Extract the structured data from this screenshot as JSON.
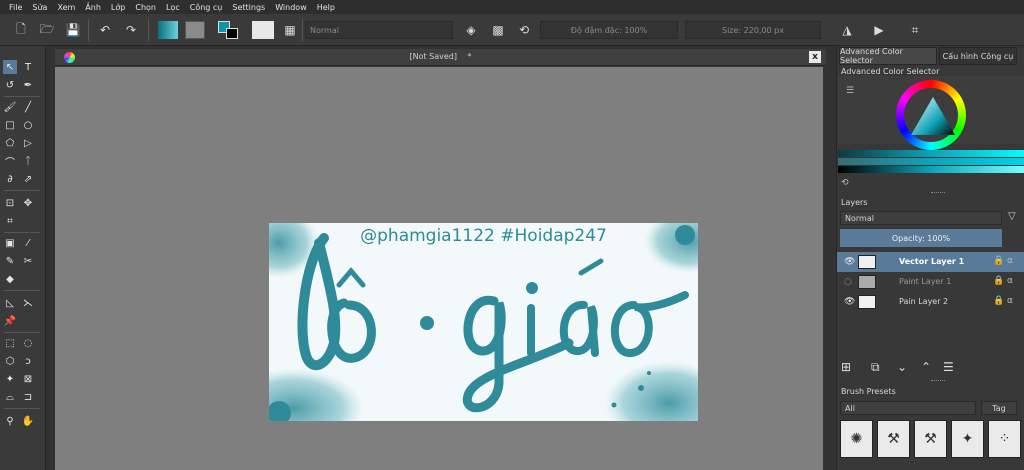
{
  "menu": [
    "File",
    "Sửa",
    "Xem",
    "Ảnh",
    "Lớp",
    "Chọn",
    "Lọc",
    "Công cụ",
    "Settings",
    "Window",
    "Help"
  ],
  "toolbar": {
    "blend_mode": "Normal",
    "opacity_label": "Độ đậm đặc: 100%",
    "size_label": "Size: 220,00 px",
    "colors": {
      "foreground": "#0f93a6",
      "background": "#000000",
      "accent": "#0ea3b8"
    }
  },
  "document": {
    "title": "[Not Saved]",
    "modified_mark": "*",
    "close_label": "x",
    "artwork": {
      "handle_text": "@phamgia1122 #Hoidap247",
      "main_text": "lô·giáo",
      "text_color": "#2f8a99"
    }
  },
  "right_panel": {
    "tabs": [
      "Advanced Color Selector",
      "Cấu hình Công cụ"
    ],
    "color_selector_title": "Advanced Color Selector",
    "layers_title": "Layers",
    "layers_blend": "Normal",
    "layers_opacity": "Opacity:  100%",
    "layers": [
      {
        "name": "Vector Layer 1",
        "selected": true
      },
      {
        "name": "Paint Layer 1",
        "selected": false
      },
      {
        "name": "Pain Layer 2",
        "selected": false
      }
    ],
    "brush_presets_title": "Brush Presets",
    "brush_filter": "All",
    "tag_label": "Tag"
  },
  "icons": {
    "new": "new-document-icon",
    "open": "open-folder-icon",
    "save": "save-icon",
    "undo": "undo-icon",
    "redo": "redo-icon"
  }
}
